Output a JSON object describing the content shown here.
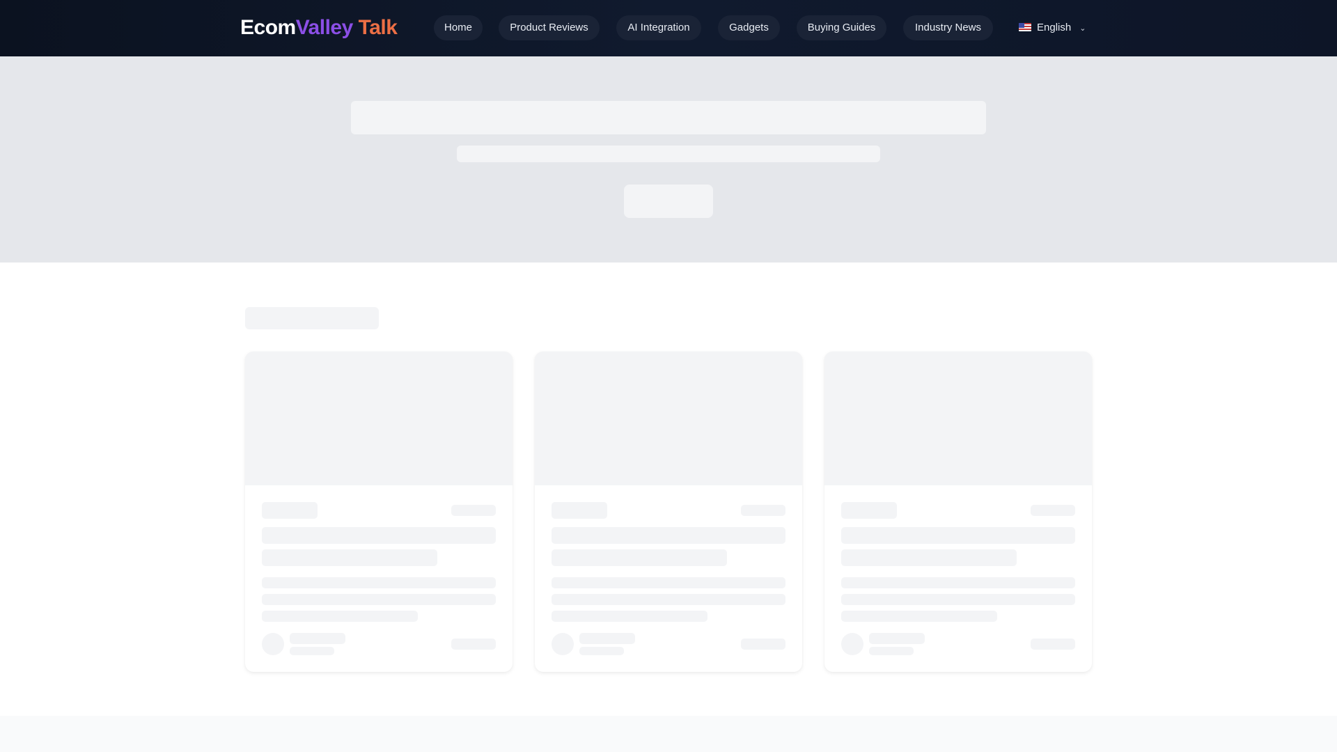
{
  "brand": {
    "part1": "Ecom",
    "part2": "Valley",
    "part3": "Talk"
  },
  "nav": {
    "items": [
      {
        "label": "Home"
      },
      {
        "label": "Product Reviews"
      },
      {
        "label": "AI Integration"
      },
      {
        "label": "Gadgets"
      },
      {
        "label": "Buying Guides"
      },
      {
        "label": "Industry News"
      }
    ]
  },
  "language": {
    "selected": "English"
  },
  "colors": {
    "header_bg": "#0b1220",
    "brand_purple": "#8b4fe6",
    "brand_orange": "#ec6f45",
    "skeleton": "#f3f4f6"
  }
}
